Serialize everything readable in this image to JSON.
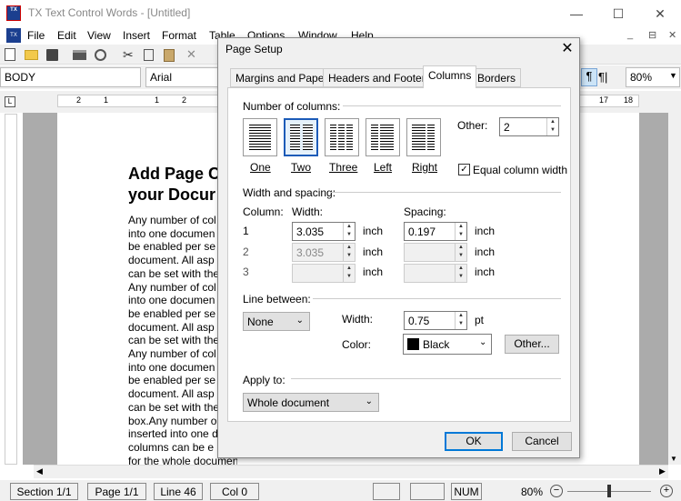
{
  "app": {
    "title": "TX Text Control Words - [Untitled]",
    "icon": "TX"
  },
  "window_controls": [
    "—",
    "☐",
    "✕"
  ],
  "menu": [
    "File",
    "Edit",
    "View",
    "Insert",
    "Format",
    "Table",
    "Options",
    "Window",
    "Help"
  ],
  "mdi_controls": [
    "_",
    "⊟",
    "✕"
  ],
  "toolbar": {
    "style": "BODY",
    "font": "Arial",
    "zoom": "80%",
    "para_mark": "¶",
    "para_mark2": "¶|"
  },
  "ruler": {
    "marks": [
      "2",
      "1",
      "1",
      "2",
      "17",
      "18"
    ]
  },
  "document": {
    "heading": [
      "Add Page C",
      "your Docur"
    ],
    "body": [
      "Any number of col",
      "into one documen",
      "be enabled per se",
      "document. All asp",
      "can be set with the",
      "Any number of col",
      "into one documen",
      "be enabled per se",
      "document. All asp",
      "can be set with the",
      "Any number of col",
      "into one documen",
      "be enabled per se",
      "document. All asp",
      "can be set with the",
      "box.Any number o",
      "inserted into one d",
      "columns can be e",
      "for the whole document. All aspects of"
    ]
  },
  "status": {
    "section": "Section 1/1",
    "page": "Page 1/1",
    "line": "Line 46",
    "col": "Col 0",
    "num": "NUM",
    "zoom": "80%"
  },
  "dialog": {
    "title": "Page Setup",
    "tabs": [
      "Margins and Paper",
      "Headers and Footers",
      "Columns",
      "Borders"
    ],
    "number_of_columns": "Number of columns:",
    "presets": [
      "One",
      "Two",
      "Three",
      "Left",
      "Right"
    ],
    "other_label": "Other:",
    "other_value": "2",
    "equal_width": "Equal column width",
    "width_spacing": "Width and spacing:",
    "col_header": "Column:",
    "width_header": "Width:",
    "spacing_header": "Spacing:",
    "rows": [
      {
        "col": "1",
        "width": "3.035",
        "spacing": "0.197",
        "unit": "inch"
      },
      {
        "col": "2",
        "width": "3.035",
        "spacing": "",
        "unit": "inch"
      },
      {
        "col": "3",
        "width": "",
        "spacing": "",
        "unit": "inch"
      }
    ],
    "line_between": "Line between:",
    "line_style": "None",
    "line_width_label": "Width:",
    "line_width": "0.75",
    "line_unit": "pt",
    "color_label": "Color:",
    "color_value": "Black",
    "color_swatch": "#000000",
    "other_button": "Other...",
    "apply_to": "Apply to:",
    "apply_value": "Whole document",
    "ok": "OK",
    "cancel": "Cancel"
  }
}
